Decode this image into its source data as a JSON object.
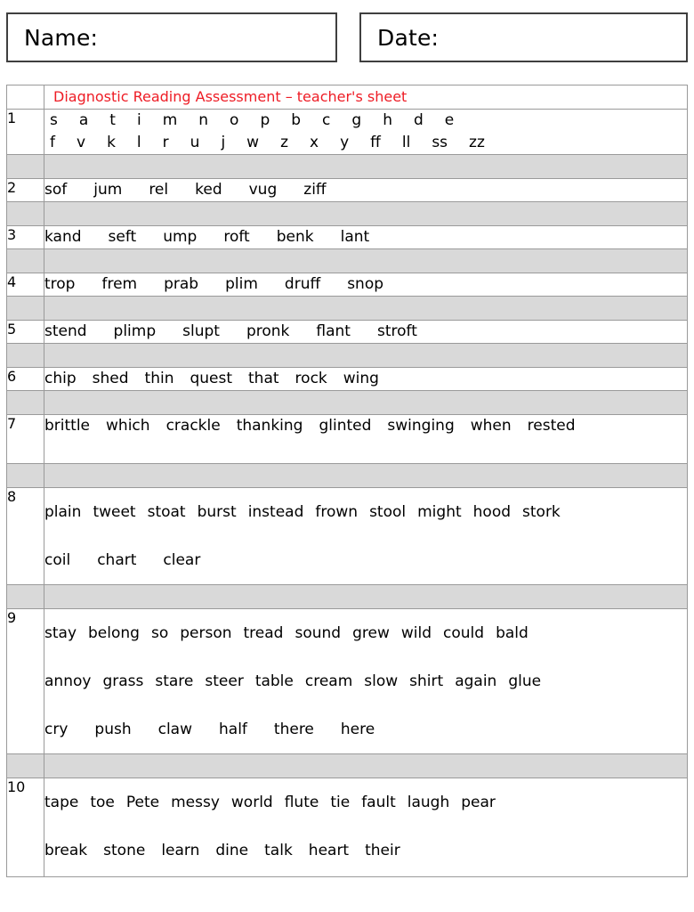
{
  "header": {
    "name_label": "Name:",
    "date_label": "Date:"
  },
  "table": {
    "title": "Diagnostic Reading Assessment – teacher's sheet",
    "title_color": "#ee1c25",
    "spacer_color": "#d9d9d9",
    "rows": [
      {
        "number": "1",
        "lines": [
          [
            "s",
            "a",
            "t",
            "i",
            "m",
            "n",
            "o",
            "p",
            "b",
            "c",
            "g",
            "h",
            "d",
            "e"
          ],
          [
            "f",
            "v",
            "k",
            "l",
            "r",
            "u",
            "j",
            "w",
            "z",
            "x",
            "y",
            "ff",
            "ll",
            "ss",
            "zz"
          ]
        ]
      },
      {
        "number": "2",
        "lines": [
          [
            "sof",
            "jum",
            "rel",
            "ked",
            "vug",
            "ziff"
          ]
        ]
      },
      {
        "number": "3",
        "lines": [
          [
            "kand",
            "seft",
            "ump",
            "roft",
            "benk",
            "lant"
          ]
        ]
      },
      {
        "number": "4",
        "lines": [
          [
            "trop",
            "frem",
            "prab",
            "plim",
            "druff",
            "snop"
          ]
        ]
      },
      {
        "number": "5",
        "lines": [
          [
            "stend",
            "plimp",
            "slupt",
            "pronk",
            "flant",
            "stroft"
          ]
        ]
      },
      {
        "number": "6",
        "lines": [
          [
            "chip",
            "shed",
            "thin",
            "quest",
            "that",
            "rock",
            "wing"
          ]
        ]
      },
      {
        "number": "7",
        "lines": [
          [
            "brittle",
            "which",
            "crackle",
            "thanking",
            "glinted",
            "swinging",
            "when",
            "rested"
          ]
        ]
      },
      {
        "number": "8",
        "lines": [
          [
            "plain",
            "tweet",
            "stoat",
            "burst",
            "instead",
            "frown",
            "stool",
            "might",
            "hood",
            "stork"
          ],
          [
            "coil",
            "chart",
            "clear"
          ]
        ]
      },
      {
        "number": "9",
        "lines": [
          [
            "stay",
            "belong",
            "so",
            "person",
            "tread",
            "sound",
            "grew",
            "wild",
            "could",
            "bald"
          ],
          [
            "annoy",
            "grass",
            "stare",
            "steer",
            "table",
            "cream",
            "slow",
            "shirt",
            "again",
            "glue"
          ],
          [
            "cry",
            "push",
            "claw",
            "half",
            "there",
            "here"
          ]
        ]
      },
      {
        "number": "10",
        "lines": [
          [
            "tape",
            "toe",
            "Pete",
            "messy",
            "world",
            "flute",
            "tie",
            "fault",
            "laugh",
            "pear"
          ],
          [
            "break",
            "stone",
            "learn",
            "dine",
            "talk",
            "heart",
            "their"
          ]
        ]
      }
    ]
  }
}
